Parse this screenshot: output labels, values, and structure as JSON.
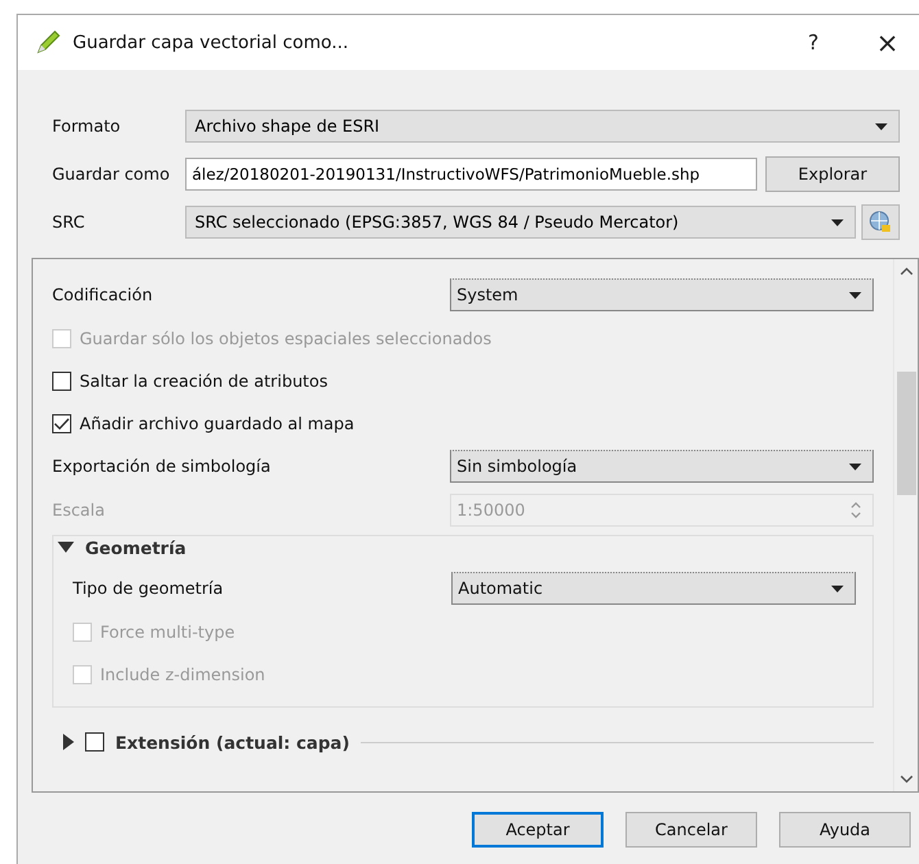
{
  "window": {
    "title": "Guardar capa vectorial como...",
    "help": "?",
    "close": "×"
  },
  "top_fields": [
    {
      "kind": "combo",
      "label": "Formato",
      "value": "Archivo shape de ESRI"
    },
    {
      "kind": "file",
      "label": "Guardar como",
      "value": "ález/20180201-20190131/InstructivoWFS/PatrimonioMueble.shp",
      "button": "Explorar"
    },
    {
      "kind": "crs",
      "label": "SRC",
      "value": "SRC seleccionado (EPSG:3857, WGS 84 / Pseudo Mercator)"
    }
  ],
  "options": [
    {
      "kind": "combo",
      "label": "Codificación",
      "value": "System",
      "disabled": false
    },
    {
      "kind": "checkbox",
      "label": "Guardar sólo los objetos espaciales seleccionados",
      "checked": false,
      "disabled": true
    },
    {
      "kind": "checkbox",
      "label": "Saltar la creación de atributos",
      "checked": false,
      "disabled": false
    },
    {
      "kind": "checkbox",
      "label": "Añadir archivo guardado al mapa",
      "checked": true,
      "disabled": false
    },
    {
      "kind": "combo",
      "label": "Exportación de simbología",
      "value": "Sin simbología",
      "disabled": false
    },
    {
      "kind": "spin",
      "label": "Escala",
      "value": "1:50000",
      "disabled": true
    }
  ],
  "geometry": {
    "title": "Geometría",
    "expanded": true,
    "options": [
      {
        "kind": "combo",
        "label": "Tipo de geometría",
        "value": "Automatic",
        "disabled": false
      },
      {
        "kind": "checkbox",
        "label": "Force multi-type",
        "checked": false,
        "disabled": true
      },
      {
        "kind": "checkbox",
        "label": "Include z-dimension",
        "checked": false,
        "disabled": true
      }
    ]
  },
  "extent": {
    "title": "Extensión (actual: capa)",
    "expanded": false,
    "checked": false
  },
  "buttons": [
    {
      "label": "Aceptar",
      "default": true
    },
    {
      "label": "Cancelar",
      "default": false
    },
    {
      "label": "Ayuda",
      "default": false
    }
  ]
}
